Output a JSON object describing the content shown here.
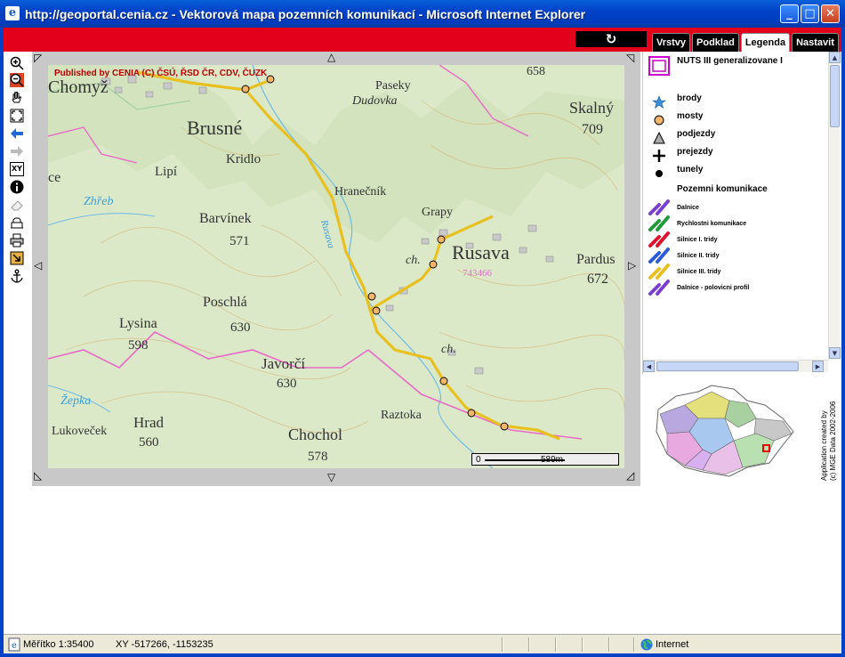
{
  "window": {
    "title": "http://geoportal.cenia.cz - Vektorová mapa pozemních komunikací - Microsoft Internet Explorer",
    "min_label": "_",
    "max_label": "□",
    "close_label": "✕"
  },
  "topbar": {
    "refresh_icon": "↻",
    "tabs": [
      {
        "label": "Vrstvy",
        "active": false
      },
      {
        "label": "Podklad",
        "active": false
      },
      {
        "label": "Legenda",
        "active": true
      },
      {
        "label": "Nastavit",
        "active": false
      }
    ]
  },
  "map": {
    "published": "Published by CENIA  (C) ČSÚ, ŘSD ČR, CDV, ČUZK",
    "scale_zero": "0",
    "scale_distance": "589m",
    "place_labels": [
      {
        "text": "Chomyž"
      },
      {
        "text": "Brusné"
      },
      {
        "text": "Paseky"
      },
      {
        "text": "Dudovka"
      },
      {
        "text": "Skalný"
      },
      {
        "text": "709"
      },
      {
        "text": "658"
      },
      {
        "text": "Kridlo"
      },
      {
        "text": "Lipí"
      },
      {
        "text": "Hranečník"
      },
      {
        "text": "Grapy"
      },
      {
        "text": "Zhřeb"
      },
      {
        "text": "Barvínek"
      },
      {
        "text": "571"
      },
      {
        "text": "Rusava"
      },
      {
        "text": "ch."
      },
      {
        "text": "Pardus"
      },
      {
        "text": "672"
      },
      {
        "text": "Poschlá"
      },
      {
        "text": "630"
      },
      {
        "text": "Lysina"
      },
      {
        "text": "598"
      },
      {
        "text": "Javorčí"
      },
      {
        "text": "630"
      },
      {
        "text": "ch."
      },
      {
        "text": "Žepka"
      },
      {
        "text": "Hrad"
      },
      {
        "text": "560"
      },
      {
        "text": "Lukoveček"
      },
      {
        "text": "Raztoka"
      },
      {
        "text": "Chochol"
      },
      {
        "text": "578"
      },
      {
        "text": "743466"
      },
      {
        "text": "ce"
      },
      {
        "text": "Rusava"
      }
    ]
  },
  "legend": {
    "nuts_label": "NUTS III generalizovane I",
    "items": [
      {
        "label": "brody",
        "icon": "star-icon"
      },
      {
        "label": "mosty",
        "icon": "circle-icon"
      },
      {
        "label": "podjezdy",
        "icon": "triangle-icon"
      },
      {
        "label": "prejezdy",
        "icon": "plus-icon"
      },
      {
        "label": "tunely",
        "icon": "dot-icon"
      }
    ],
    "roads_heading": "Pozemni komunikace",
    "roads": [
      {
        "label": "Dalnice",
        "color": "#7b3fd0"
      },
      {
        "label": "Rychlostni komunikace",
        "color": "#1e9a3a"
      },
      {
        "label": "Silnice I. tridy",
        "color": "#e0102a"
      },
      {
        "label": "Silnice II. tridy",
        "color": "#2a5bd8"
      },
      {
        "label": "Silnice III. tridy",
        "color": "#e8c020"
      },
      {
        "label": "Dalnice - polovicni profil",
        "color": "#7b3fd0"
      }
    ]
  },
  "credit": {
    "line1": "Application created by",
    "line2": "(c) MGE Data 2002-2006"
  },
  "status": {
    "scale": "Měřítko 1:35400",
    "coords": "XY -517266, -1153235",
    "zone": "Internet"
  },
  "toolbar": {
    "tools": [
      "zoom-in-icon",
      "zoom-out-icon",
      "pan-hand-icon",
      "zoom-extent-icon",
      "back-arrow-icon",
      "forward-arrow-icon",
      "xy-icon",
      "info-icon",
      "eraser-icon",
      "measure-icon",
      "print-icon",
      "export-icon",
      "anchor-icon"
    ],
    "xy_label": "XY"
  },
  "colors": {
    "brand_red": "#e3001b",
    "map_green": "#dbe9c9",
    "road_yellow": "#e8c020"
  }
}
